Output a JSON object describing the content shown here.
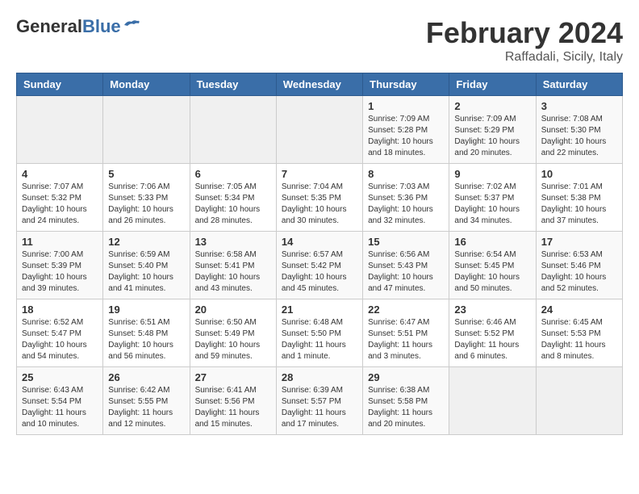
{
  "header": {
    "logo_general": "General",
    "logo_blue": "Blue",
    "month_year": "February 2024",
    "location": "Raffadali, Sicily, Italy"
  },
  "calendar": {
    "days_of_week": [
      "Sunday",
      "Monday",
      "Tuesday",
      "Wednesday",
      "Thursday",
      "Friday",
      "Saturday"
    ],
    "weeks": [
      [
        {
          "day": "",
          "info": ""
        },
        {
          "day": "",
          "info": ""
        },
        {
          "day": "",
          "info": ""
        },
        {
          "day": "",
          "info": ""
        },
        {
          "day": "1",
          "info": "Sunrise: 7:09 AM\nSunset: 5:28 PM\nDaylight: 10 hours\nand 18 minutes."
        },
        {
          "day": "2",
          "info": "Sunrise: 7:09 AM\nSunset: 5:29 PM\nDaylight: 10 hours\nand 20 minutes."
        },
        {
          "day": "3",
          "info": "Sunrise: 7:08 AM\nSunset: 5:30 PM\nDaylight: 10 hours\nand 22 minutes."
        }
      ],
      [
        {
          "day": "4",
          "info": "Sunrise: 7:07 AM\nSunset: 5:32 PM\nDaylight: 10 hours\nand 24 minutes."
        },
        {
          "day": "5",
          "info": "Sunrise: 7:06 AM\nSunset: 5:33 PM\nDaylight: 10 hours\nand 26 minutes."
        },
        {
          "day": "6",
          "info": "Sunrise: 7:05 AM\nSunset: 5:34 PM\nDaylight: 10 hours\nand 28 minutes."
        },
        {
          "day": "7",
          "info": "Sunrise: 7:04 AM\nSunset: 5:35 PM\nDaylight: 10 hours\nand 30 minutes."
        },
        {
          "day": "8",
          "info": "Sunrise: 7:03 AM\nSunset: 5:36 PM\nDaylight: 10 hours\nand 32 minutes."
        },
        {
          "day": "9",
          "info": "Sunrise: 7:02 AM\nSunset: 5:37 PM\nDaylight: 10 hours\nand 34 minutes."
        },
        {
          "day": "10",
          "info": "Sunrise: 7:01 AM\nSunset: 5:38 PM\nDaylight: 10 hours\nand 37 minutes."
        }
      ],
      [
        {
          "day": "11",
          "info": "Sunrise: 7:00 AM\nSunset: 5:39 PM\nDaylight: 10 hours\nand 39 minutes."
        },
        {
          "day": "12",
          "info": "Sunrise: 6:59 AM\nSunset: 5:40 PM\nDaylight: 10 hours\nand 41 minutes."
        },
        {
          "day": "13",
          "info": "Sunrise: 6:58 AM\nSunset: 5:41 PM\nDaylight: 10 hours\nand 43 minutes."
        },
        {
          "day": "14",
          "info": "Sunrise: 6:57 AM\nSunset: 5:42 PM\nDaylight: 10 hours\nand 45 minutes."
        },
        {
          "day": "15",
          "info": "Sunrise: 6:56 AM\nSunset: 5:43 PM\nDaylight: 10 hours\nand 47 minutes."
        },
        {
          "day": "16",
          "info": "Sunrise: 6:54 AM\nSunset: 5:45 PM\nDaylight: 10 hours\nand 50 minutes."
        },
        {
          "day": "17",
          "info": "Sunrise: 6:53 AM\nSunset: 5:46 PM\nDaylight: 10 hours\nand 52 minutes."
        }
      ],
      [
        {
          "day": "18",
          "info": "Sunrise: 6:52 AM\nSunset: 5:47 PM\nDaylight: 10 hours\nand 54 minutes."
        },
        {
          "day": "19",
          "info": "Sunrise: 6:51 AM\nSunset: 5:48 PM\nDaylight: 10 hours\nand 56 minutes."
        },
        {
          "day": "20",
          "info": "Sunrise: 6:50 AM\nSunset: 5:49 PM\nDaylight: 10 hours\nand 59 minutes."
        },
        {
          "day": "21",
          "info": "Sunrise: 6:48 AM\nSunset: 5:50 PM\nDaylight: 11 hours\nand 1 minute."
        },
        {
          "day": "22",
          "info": "Sunrise: 6:47 AM\nSunset: 5:51 PM\nDaylight: 11 hours\nand 3 minutes."
        },
        {
          "day": "23",
          "info": "Sunrise: 6:46 AM\nSunset: 5:52 PM\nDaylight: 11 hours\nand 6 minutes."
        },
        {
          "day": "24",
          "info": "Sunrise: 6:45 AM\nSunset: 5:53 PM\nDaylight: 11 hours\nand 8 minutes."
        }
      ],
      [
        {
          "day": "25",
          "info": "Sunrise: 6:43 AM\nSunset: 5:54 PM\nDaylight: 11 hours\nand 10 minutes."
        },
        {
          "day": "26",
          "info": "Sunrise: 6:42 AM\nSunset: 5:55 PM\nDaylight: 11 hours\nand 12 minutes."
        },
        {
          "day": "27",
          "info": "Sunrise: 6:41 AM\nSunset: 5:56 PM\nDaylight: 11 hours\nand 15 minutes."
        },
        {
          "day": "28",
          "info": "Sunrise: 6:39 AM\nSunset: 5:57 PM\nDaylight: 11 hours\nand 17 minutes."
        },
        {
          "day": "29",
          "info": "Sunrise: 6:38 AM\nSunset: 5:58 PM\nDaylight: 11 hours\nand 20 minutes."
        },
        {
          "day": "",
          "info": ""
        },
        {
          "day": "",
          "info": ""
        }
      ]
    ]
  }
}
